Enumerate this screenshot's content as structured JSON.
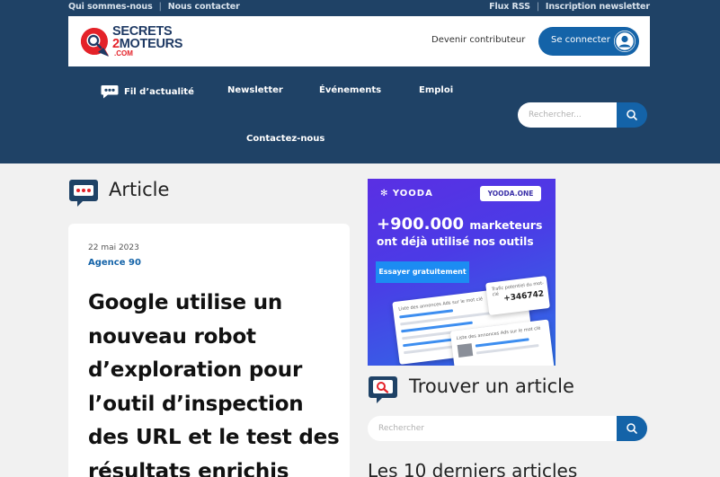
{
  "top_links": {
    "left": [
      "Qui sommes-nous",
      "Nous contacter"
    ],
    "right": [
      "Flux RSS",
      "Inscription newsletter"
    ],
    "separator": "|"
  },
  "logo": {
    "line1": "SECRETS",
    "line2_num": "2",
    "line2_text": "MOTEURS",
    "line3": ".COM"
  },
  "header": {
    "contributor_link": "Devenir contributeur",
    "connect_button": "Se connecter",
    "connect_icon": "user-circle-icon"
  },
  "nav": {
    "items": [
      "Fil d’actualité",
      "Newsletter",
      "Événements",
      "Emploi",
      "Contactez-nous"
    ],
    "fil_icon": "chat-bubble-icon"
  },
  "search_top": {
    "placeholder": "Rechercher...",
    "icon": "search-icon"
  },
  "article_section": {
    "heading": "Article"
  },
  "article": {
    "date": "22 mai 2023",
    "author": "Agence 90",
    "title": "Google utilise un nouveau robot d’exploration pour l’outil d’inspection des URL et le test des résultats enrichis"
  },
  "ad": {
    "brand": "YOODA",
    "badge": "YOODA.ONE",
    "headline_number": "+900.000",
    "headline_word": "marketeurs",
    "subline": "ont déjà utilisé nos outils",
    "cta": "Essayer gratuitement",
    "stat_label": "Trafic potentiel du mot-clé",
    "stat_value": "+346742",
    "panel1_label": "Liste des annonces Ads sur le mot clé",
    "panel3_label": "Liste des annonces Ads sur le mot clé",
    "colors": {
      "gradient_start": "#5a2fe3",
      "gradient_end": "#2e6fe6",
      "cta": "#1c8cf2"
    }
  },
  "find_section": {
    "heading": "Trouver un article",
    "placeholder": "Rechercher"
  },
  "last_section": {
    "heading": "Les 10 derniers articles"
  },
  "colors": {
    "header_bg": "#1f4266",
    "accent_blue": "#1463a8",
    "brand_red": "#e42229",
    "page_bg": "#f1f1f1"
  }
}
